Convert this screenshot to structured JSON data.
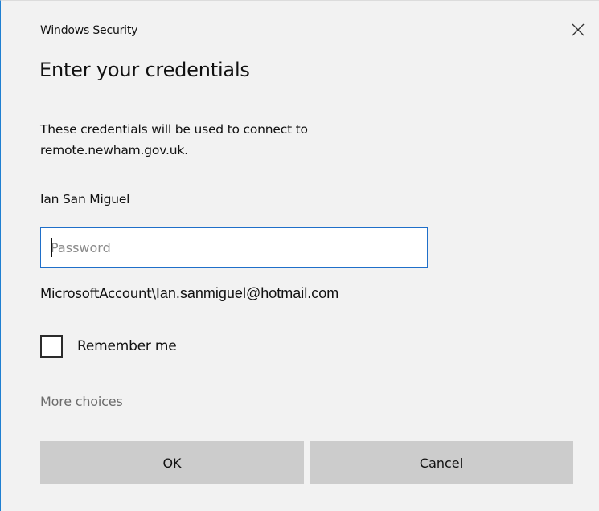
{
  "window": {
    "title": "Windows Security",
    "close_icon": "close-icon"
  },
  "heading": "Enter your credentials",
  "description": "These credentials will be used to connect to remote.newham.gov.uk.",
  "user": {
    "display_name": "Ian San Miguel"
  },
  "password": {
    "placeholder": "Password",
    "value": ""
  },
  "account": {
    "prefix": "MicrosoftAccount\\",
    "email": "Ian.sanmiguel@hotmail.com"
  },
  "remember": {
    "label": "Remember me",
    "checked": false
  },
  "more_choices": "More choices",
  "buttons": {
    "ok_label": "OK",
    "cancel_label": "Cancel"
  },
  "colors": {
    "accent": "#1f6fc9",
    "dialog_background": "#f2f2f2",
    "button_background": "#cccccc",
    "muted_text": "#6b6b6b"
  }
}
